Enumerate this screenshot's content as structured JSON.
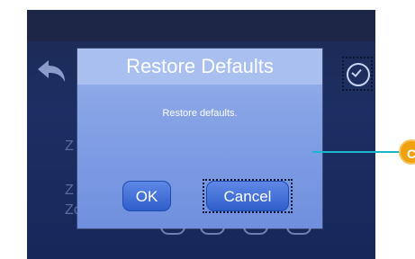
{
  "background_zones": [
    {
      "label": "Z"
    },
    {
      "label": "Z"
    },
    {
      "label": "Zone C"
    }
  ],
  "icons": {
    "back": "back-arrow-icon",
    "confirm": "check-circle-icon"
  },
  "dialog": {
    "title": "Restore Defaults",
    "message": "Restore defaults.",
    "ok_label": "OK",
    "cancel_label": "Cancel"
  },
  "callout": {
    "label": "C",
    "color": "#f0a20e",
    "line_color": "#18b7cc"
  },
  "colors": {
    "screen_bg": "#1c2e63",
    "dialog_bg": "#86a3e6",
    "button_bg": "#2f5fcb"
  }
}
